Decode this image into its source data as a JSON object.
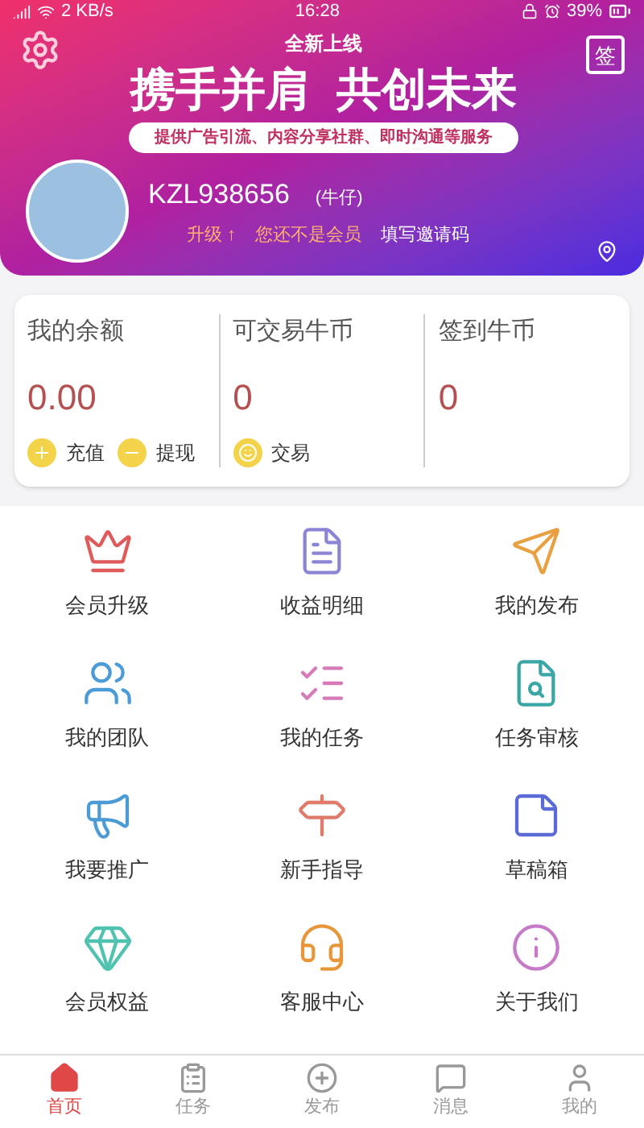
{
  "status_bar": {
    "speed": "2 KB/s",
    "time": "16:28",
    "battery": "39%"
  },
  "banner": {
    "tagline": "全新上线",
    "headline": "携手并肩  共创未来",
    "subtitle": "提供广告引流、内容分享社群、即时沟通等服务",
    "sign_in": "签"
  },
  "profile": {
    "username": "KZL938656",
    "nickname": "(牛仔)",
    "upgrade": "升级 ↑",
    "member_status": "您还不是会员",
    "invite": "填写邀请码"
  },
  "balances": [
    {
      "label": "我的余额",
      "value": "0.00",
      "actions": [
        {
          "kind": "plus",
          "label": "充值"
        },
        {
          "kind": "minus",
          "label": "提现"
        }
      ]
    },
    {
      "label": "可交易牛币",
      "value": "0",
      "actions": [
        {
          "kind": "trade",
          "label": "交易"
        }
      ]
    },
    {
      "label": "签到牛币",
      "value": "0"
    }
  ],
  "menu": [
    {
      "label": "会员升级"
    },
    {
      "label": "收益明细"
    },
    {
      "label": "我的发布"
    },
    {
      "label": "我的团队"
    },
    {
      "label": "我的任务"
    },
    {
      "label": "任务审核"
    },
    {
      "label": "我要推广"
    },
    {
      "label": "新手指导"
    },
    {
      "label": "草稿箱"
    },
    {
      "label": "会员权益"
    },
    {
      "label": "客服中心"
    },
    {
      "label": "关于我们"
    }
  ],
  "tabs": [
    {
      "label": "首页",
      "selected": true
    },
    {
      "label": "任务",
      "selected": false
    },
    {
      "label": "发布",
      "selected": false
    },
    {
      "label": "消息",
      "selected": false
    },
    {
      "label": "我的",
      "selected": false
    }
  ]
}
